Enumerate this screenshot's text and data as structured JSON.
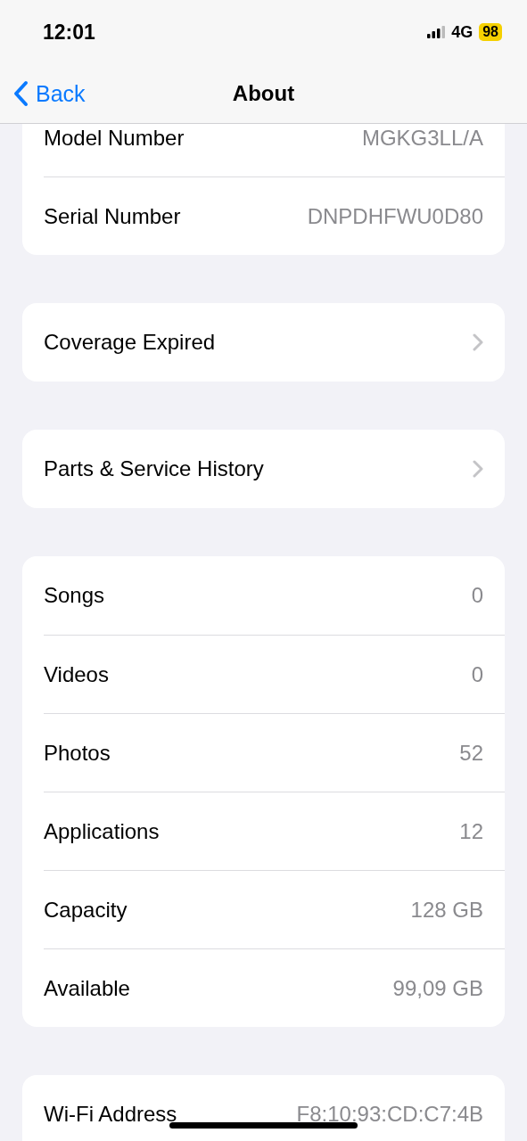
{
  "status_bar": {
    "time": "12:01",
    "network": "4G",
    "battery": "98"
  },
  "nav": {
    "back": "Back",
    "title": "About"
  },
  "groups": [
    {
      "cut_top": true,
      "rows": [
        {
          "kind": "info",
          "label": "Model Number",
          "value": "MGKG3LL/A"
        },
        {
          "kind": "info",
          "label": "Serial Number",
          "value": "DNPDHFWU0D80"
        }
      ]
    },
    {
      "cut_top": false,
      "rows": [
        {
          "kind": "link",
          "label": "Coverage Expired"
        }
      ]
    },
    {
      "cut_top": false,
      "rows": [
        {
          "kind": "link",
          "label": "Parts & Service History"
        }
      ]
    },
    {
      "cut_top": false,
      "rows": [
        {
          "kind": "info",
          "label": "Songs",
          "value": "0"
        },
        {
          "kind": "info",
          "label": "Videos",
          "value": "0"
        },
        {
          "kind": "info",
          "label": "Photos",
          "value": "52"
        },
        {
          "kind": "info",
          "label": "Applications",
          "value": "12"
        },
        {
          "kind": "info",
          "label": "Capacity",
          "value": "128 GB"
        },
        {
          "kind": "info",
          "label": "Available",
          "value": "99,09 GB"
        }
      ]
    },
    {
      "cut_top": false,
      "rows": [
        {
          "kind": "info",
          "label": "Wi-Fi Address",
          "value": "F8:10:93:CD:C7:4B"
        }
      ]
    }
  ]
}
